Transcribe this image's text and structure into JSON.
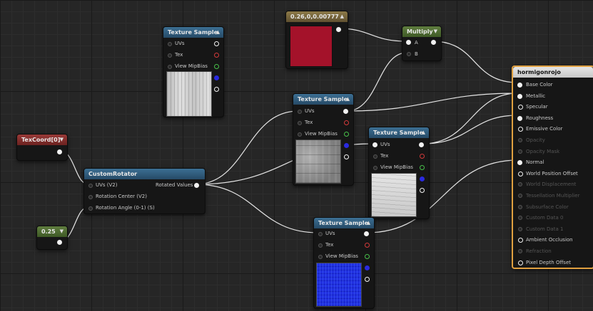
{
  "colors": {
    "red_swatch": "#a4122a",
    "result_header": "#e6e6e6",
    "result_border": "#e0a040"
  },
  "nodes": {
    "tex_sample_1": {
      "title": "Texture Sample",
      "pins": [
        "UVs",
        "Tex",
        "View MipBias"
      ],
      "preview": "wood"
    },
    "constant_color": {
      "title": "0.26,0,0.00777",
      "swatch_color": "#a4122a"
    },
    "multiply": {
      "title": "Multiply",
      "pin_a": "A",
      "pin_b": "B"
    },
    "tex_sample_2": {
      "title": "Texture Sample",
      "pins": [
        "UVs",
        "Tex",
        "View MipBias"
      ],
      "preview": "concrete"
    },
    "tex_sample_3": {
      "title": "Texture Sample",
      "pins": [
        "UVs",
        "Tex",
        "View MipBias"
      ],
      "preview": "whitewood"
    },
    "tex_sample_4": {
      "title": "Texture Sample",
      "pins": [
        "UVs",
        "Tex",
        "View MipBias"
      ],
      "preview": "normal"
    },
    "texcoord": {
      "title": "TexCoord[0]"
    },
    "custom_rotator": {
      "title": "CustomRotator",
      "inputs": [
        "UVs (V2)",
        "Rotation Center (V2)",
        "Rotation Angle (0-1) (S)"
      ],
      "output": "Rotated Values"
    },
    "constant": {
      "title": "0.25"
    },
    "material": {
      "title": "hormigonrojo",
      "inputs": [
        {
          "label": "Base Color",
          "state": "full"
        },
        {
          "label": "Metallic",
          "state": "full"
        },
        {
          "label": "Specular",
          "state": "ring"
        },
        {
          "label": "Roughness",
          "state": "full"
        },
        {
          "label": "Emissive Color",
          "state": "ring"
        },
        {
          "label": "Opacity",
          "state": "dim"
        },
        {
          "label": "Opacity Mask",
          "state": "dim"
        },
        {
          "label": "Normal",
          "state": "full"
        },
        {
          "label": "World Position Offset",
          "state": "ring"
        },
        {
          "label": "World Displacement",
          "state": "dim"
        },
        {
          "label": "Tessellation Multiplier",
          "state": "dim"
        },
        {
          "label": "Subsurface Color",
          "state": "dim"
        },
        {
          "label": "Custom Data 0",
          "state": "dim"
        },
        {
          "label": "Custom Data 1",
          "state": "dim"
        },
        {
          "label": "Ambient Occlusion",
          "state": "ring"
        },
        {
          "label": "Refraction",
          "state": "dim"
        },
        {
          "label": "Pixel Depth Offset",
          "state": "ring"
        }
      ]
    }
  }
}
